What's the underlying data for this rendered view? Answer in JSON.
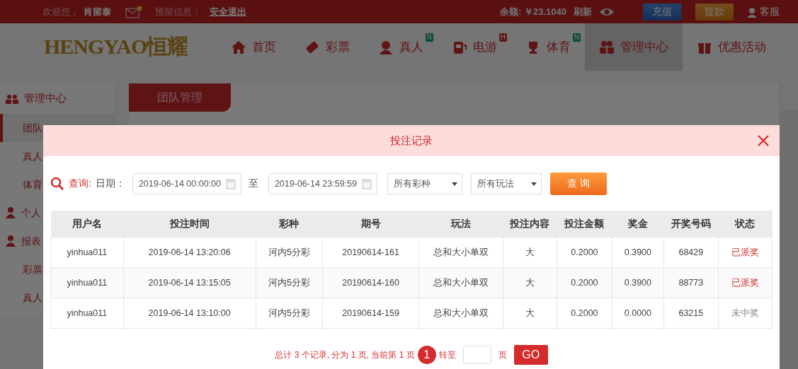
{
  "top_bar": {
    "greeting": "欢迎您，",
    "username": "肖留泰",
    "mail_unread": true,
    "notice_label": "预留信息：",
    "logout": "安全退出",
    "balance": "余额: ￥23.1040",
    "refresh": "刷新",
    "deposit": "充值",
    "withdraw": "提款",
    "service": "客服"
  },
  "nav": {
    "logo": "HENGYAO恒耀",
    "items": [
      {
        "label": "首页",
        "selected": false
      },
      {
        "label": "彩票",
        "selected": false
      },
      {
        "label": "真人",
        "badge": "N",
        "selected": false
      },
      {
        "label": "电游",
        "badge": "H",
        "selected": false
      },
      {
        "label": "体育",
        "badge": "N",
        "selected": false
      },
      {
        "label": "管理中心",
        "selected": true
      },
      {
        "label": "优惠活动",
        "selected": false
      }
    ]
  },
  "sidebar": {
    "title": "管理中心",
    "items": [
      {
        "kind": "link",
        "label": "团队",
        "selected": true
      },
      {
        "kind": "link",
        "label": "真人",
        "selected": false
      },
      {
        "kind": "link",
        "label": "体育",
        "selected": false
      },
      {
        "kind": "group",
        "label": "个人",
        "selected": false
      },
      {
        "kind": "group",
        "label": "报表",
        "selected": false
      },
      {
        "kind": "link",
        "label": "彩票",
        "selected": false
      },
      {
        "kind": "link",
        "label": "真人",
        "selected": false
      }
    ]
  },
  "content_tab": "团队管理",
  "modal": {
    "title": "投注记录",
    "filters": {
      "query_label": "查询:",
      "date_label": "日期：",
      "start": "2019-06-14 00:00:00",
      "to": "至",
      "end": "2019-06-14 23:59:59",
      "lottery": "所有彩种",
      "play": "所有玩法",
      "submit": "查 询"
    },
    "table": {
      "columns": [
        "用户名",
        "投注时间",
        "彩种",
        "期号",
        "玩法",
        "投注内容",
        "投注金额",
        "奖金",
        "开奖号码",
        "状态"
      ],
      "rows": [
        {
          "cells": [
            "yinhua011",
            "2019-06-14 13:20:06",
            "河内5分彩",
            "20190614-161",
            "总和大小单双",
            "大",
            "0.2000",
            "0.3900",
            "68429",
            "已派奖"
          ],
          "won": true
        },
        {
          "cells": [
            "yinhua011",
            "2019-06-14 13:15:05",
            "河内5分彩",
            "20190614-160",
            "总和大小单双",
            "大",
            "0.2000",
            "0.3900",
            "88773",
            "已派奖"
          ],
          "won": true
        },
        {
          "cells": [
            "yinhua011",
            "2019-06-14 13:10:00",
            "河内5分彩",
            "20190614-159",
            "总和大小单双",
            "大",
            "0.2000",
            "0.0000",
            "63215",
            "未中奖"
          ],
          "won": false
        }
      ]
    },
    "pagination": {
      "summary": "总计 3 个记录, 分为 1 页, 当前第 1 页",
      "pages": [
        {
          "label": "1",
          "selected": true
        }
      ],
      "goto_label": "转至",
      "unit": "页",
      "go": "GO"
    }
  }
}
